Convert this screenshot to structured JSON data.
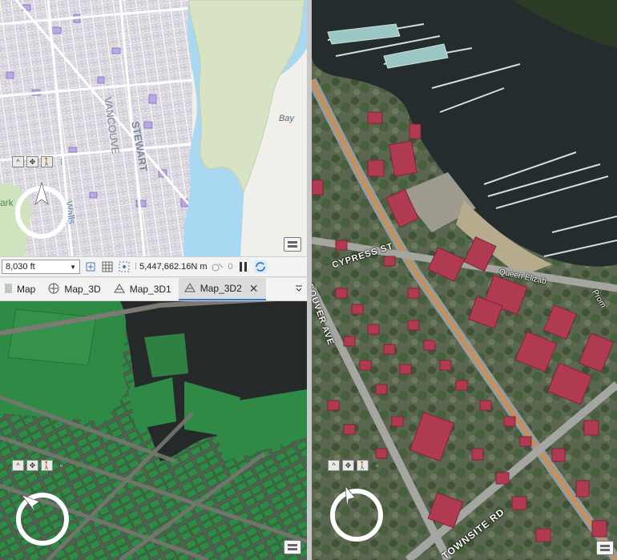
{
  "status_bar": {
    "scale_value": "8,030 ft",
    "coordinates": "5,447,662.16N m",
    "selected_count": "0"
  },
  "tabs": [
    {
      "label": "Map"
    },
    {
      "label": "Map_3D"
    },
    {
      "label": "Map_3D1"
    },
    {
      "label": "Map_3D2",
      "active": true
    }
  ],
  "topo_map": {
    "labels": {
      "bay": "Bay",
      "stewart": "STEWART",
      "vancouver": "VANCOUVE",
      "walls": "Walls",
      "park": "ark"
    }
  },
  "satellite_map": {
    "street_labels": {
      "cypress": "CYPRESS ST",
      "vancouver_ave": "COUVER AVE",
      "townsite": "TOWNSITE RD",
      "queen_elizabeth": "Queen Elizab",
      "prom": "Prom"
    }
  },
  "colors": {
    "water": "#a9d9f2",
    "land_green": "#d7e3c3",
    "buildings_3d_green": "#2f8a45",
    "buildings_red": "#b03a52",
    "road_orange": "#e08a3a",
    "active_tab_accent": "#2f7bd2"
  },
  "icons": [
    "navigator-collapse-icon",
    "full-extent-icon",
    "walk-icon",
    "layers-icon",
    "lock-icon",
    "grid-icon",
    "snapping-icon",
    "selection-icon",
    "pause-icon",
    "refresh-icon",
    "map-tab-icon",
    "map3d-tab-icon",
    "close-icon",
    "chevron-down-icon"
  ]
}
